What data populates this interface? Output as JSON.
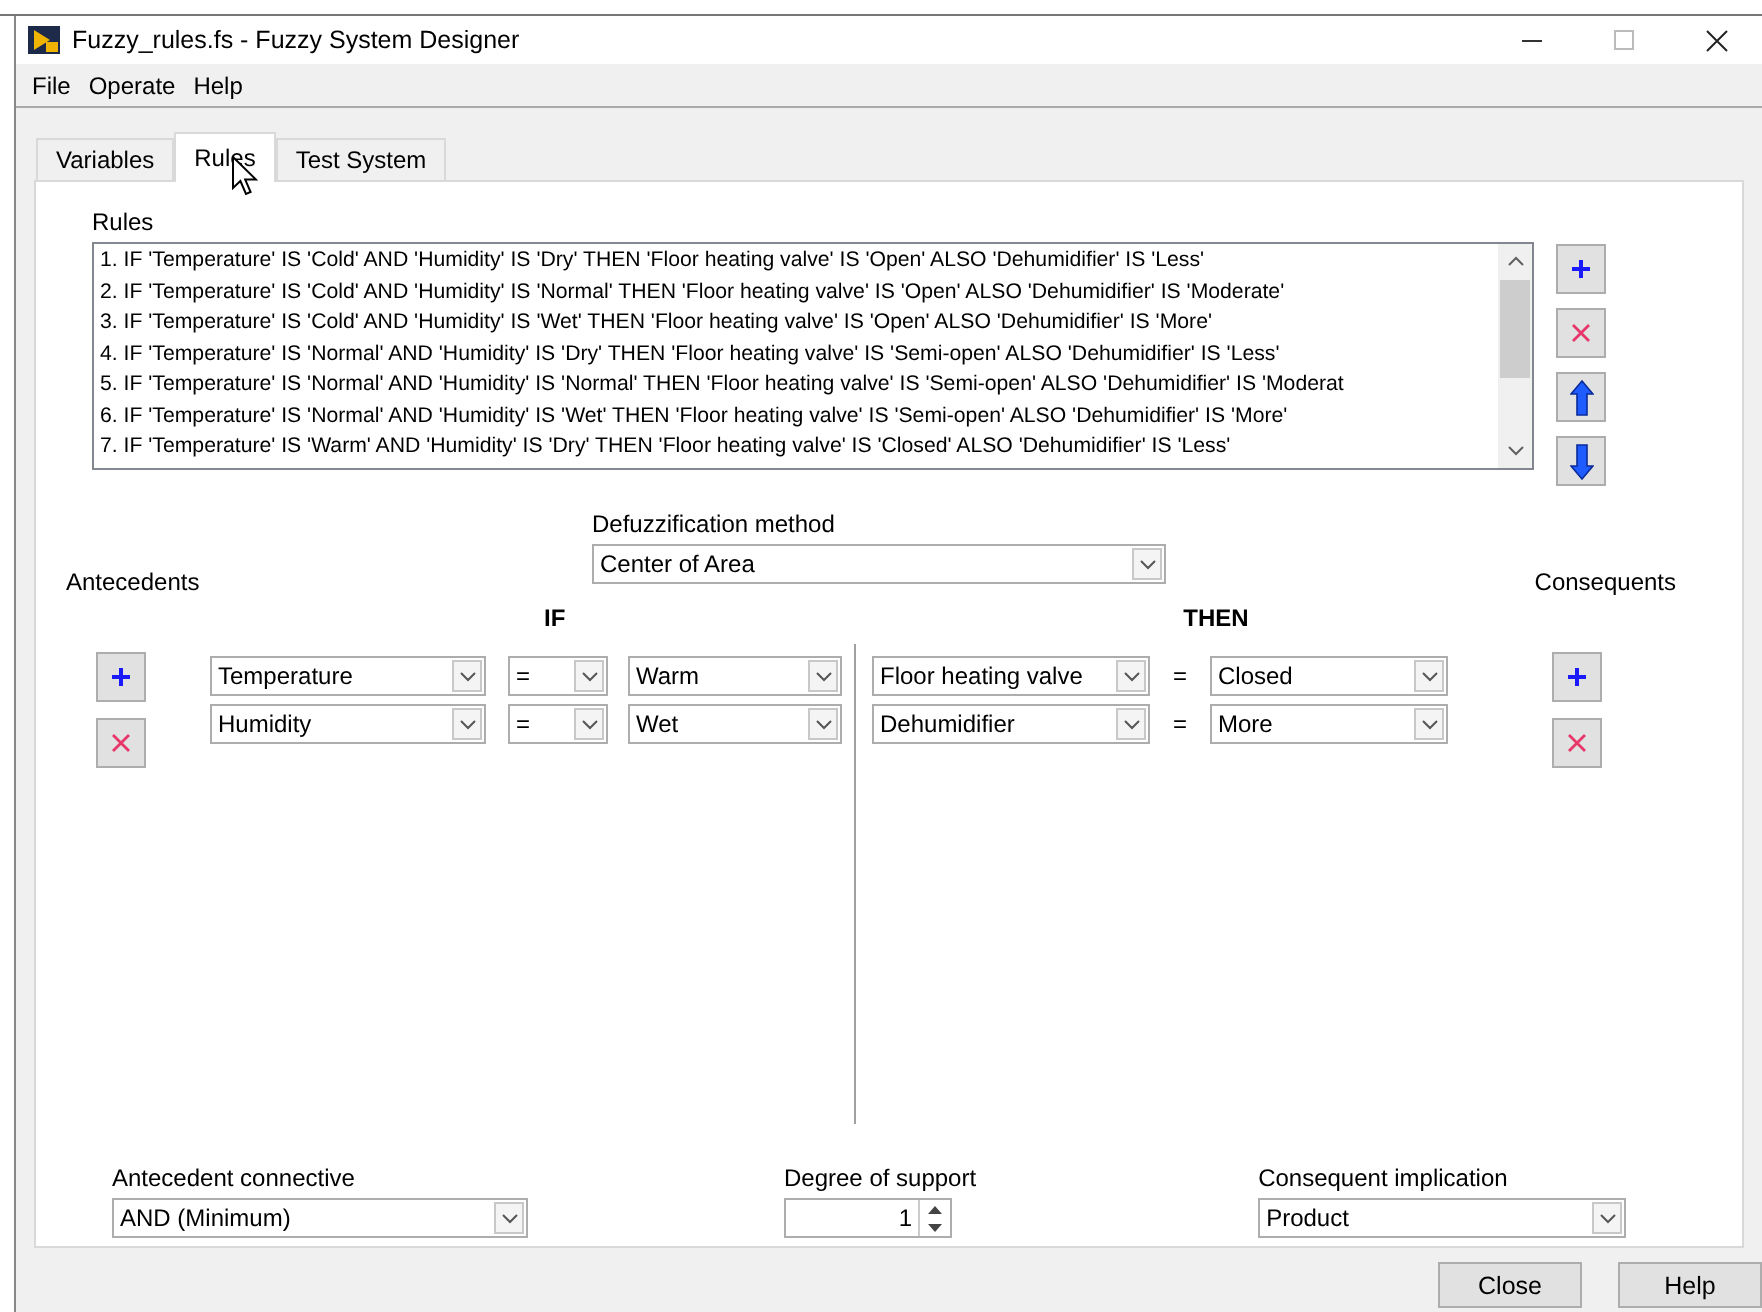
{
  "window": {
    "title": "Fuzzy_rules.fs - Fuzzy System Designer"
  },
  "menu": [
    "File",
    "Operate",
    "Help"
  ],
  "tabs": [
    {
      "label": "Variables",
      "selected": false
    },
    {
      "label": "Rules",
      "selected": true
    },
    {
      "label": "Test System",
      "selected": false
    }
  ],
  "rules": {
    "label": "Rules",
    "items": [
      "1. IF 'Temperature' IS 'Cold' AND 'Humidity' IS 'Dry' THEN 'Floor heating valve' IS 'Open' ALSO 'Dehumidifier' IS 'Less'",
      "2. IF 'Temperature' IS 'Cold' AND 'Humidity' IS 'Normal' THEN 'Floor heating valve' IS 'Open' ALSO 'Dehumidifier' IS 'Moderate'",
      "3. IF 'Temperature' IS 'Cold' AND 'Humidity' IS 'Wet' THEN 'Floor heating valve' IS 'Open' ALSO 'Dehumidifier' IS 'More'",
      "4. IF 'Temperature' IS 'Normal' AND 'Humidity' IS 'Dry' THEN 'Floor heating valve' IS 'Semi-open' ALSO 'Dehumidifier' IS 'Less'",
      "5. IF 'Temperature' IS 'Normal' AND 'Humidity' IS 'Normal' THEN 'Floor heating valve' IS 'Semi-open' ALSO 'Dehumidifier' IS 'Moderat",
      "6. IF 'Temperature' IS 'Normal' AND 'Humidity' IS 'Wet' THEN 'Floor heating valve' IS 'Semi-open' ALSO 'Dehumidifier' IS 'More'",
      "7. IF 'Temperature' IS 'Warm' AND 'Humidity' IS 'Dry' THEN 'Floor heating valve' IS 'Closed' ALSO 'Dehumidifier' IS 'Less'"
    ]
  },
  "rule_buttons": [
    {
      "kind": "add"
    },
    {
      "kind": "delete"
    },
    {
      "kind": "up"
    },
    {
      "kind": "down"
    }
  ],
  "defuzzification": {
    "label": "Defuzzification method",
    "value": "Center of Area"
  },
  "antecedents": {
    "label": "Antecedents",
    "header": "IF",
    "rows": [
      {
        "variable": "Temperature",
        "operator": "=",
        "term": "Warm"
      },
      {
        "variable": "Humidity",
        "operator": "=",
        "term": "Wet"
      }
    ]
  },
  "consequents": {
    "label": "Consequents",
    "header": "THEN",
    "rows": [
      {
        "variable": "Floor heating valve",
        "operator": "=",
        "term": "Closed"
      },
      {
        "variable": "Dehumidifier",
        "operator": "=",
        "term": "More"
      }
    ]
  },
  "antecedent_connective": {
    "label": "Antecedent connective",
    "value": "AND (Minimum)"
  },
  "degree_of_support": {
    "label": "Degree of support",
    "value": "1"
  },
  "consequent_implication": {
    "label": "Consequent implication",
    "value": "Product"
  },
  "buttons": [
    "Close",
    "Help"
  ]
}
